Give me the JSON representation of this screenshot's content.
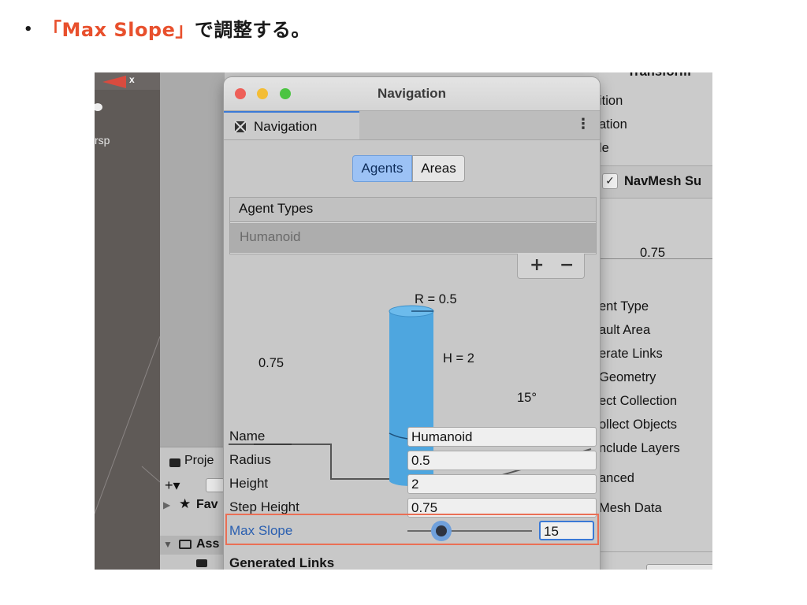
{
  "slide": {
    "bullet": "•",
    "title_accent": "「Max Slope」",
    "title_rest": "で調整する。"
  },
  "scene": {
    "x_label": "x",
    "persp_label": "rsp"
  },
  "project": {
    "tab_label": "Proje",
    "add_label": "+▾",
    "favorites_label": "Fav",
    "assets_label": "Ass"
  },
  "inspector": {
    "transform_label": "Transform",
    "rows_top": [
      "ition",
      "ation",
      "le"
    ],
    "component": "NavMesh Su",
    "value": "0.75",
    "rows": [
      "ent Type",
      "ault Area",
      "erate Links",
      "Geometry",
      "ect Collection",
      "ollect Objects",
      "nclude Layers"
    ],
    "advanced": "anced",
    "navmesh_data": "Mesh Data"
  },
  "window": {
    "title": "Navigation",
    "tab_label": "Navigation",
    "tab_menu": "⋮",
    "segments": {
      "agents": "Agents",
      "areas": "Areas"
    },
    "agent_types_header": "Agent Types",
    "agent_selected": "Humanoid",
    "plus": "+",
    "minus": "−",
    "diagram": {
      "radius": "R = 0.5",
      "height": "H = 2",
      "step": "0.75",
      "slope": "15°"
    },
    "fields": {
      "name_label": "Name",
      "name_value": "Humanoid",
      "radius_label": "Radius",
      "radius_value": "0.5",
      "height_label": "Height",
      "height_value": "2",
      "step_label": "Step Height",
      "step_value": "0.75",
      "slope_label": "Max Slope",
      "slope_value": "15"
    },
    "generated_links": "Generated Links"
  },
  "colors": {
    "accent": "#e8502d",
    "highlight": "#ea6f55",
    "selected_segment": "#9cc2f5",
    "cylinder": "#4ea6df"
  }
}
